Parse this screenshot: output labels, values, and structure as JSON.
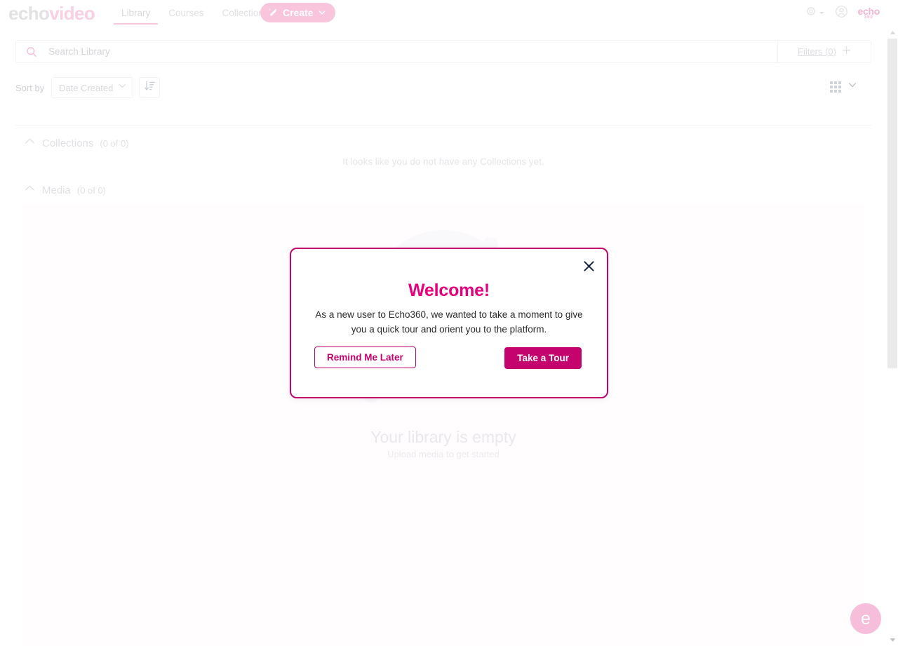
{
  "brand": {
    "part1": "echo",
    "part2": "video"
  },
  "nav": {
    "tabs": [
      {
        "label": "Library",
        "active": true
      },
      {
        "label": "Courses",
        "active": false
      },
      {
        "label": "Collections",
        "active": false
      }
    ],
    "create_label": "Create",
    "logo_echo": "echo",
    "logo_360": "360"
  },
  "search": {
    "placeholder": "Search Library",
    "value": "",
    "filters_label": "Filters (0)"
  },
  "sort": {
    "label": "Sort by",
    "value": "Date Created",
    "options": [
      "Date Created"
    ]
  },
  "sections": {
    "collections": {
      "title": "Collections",
      "count": "(0 of 0)",
      "empty_message": "It looks like you do not have any Collections yet."
    },
    "media": {
      "title": "Media",
      "count": "(0 of 0)",
      "empty_title": "Your library is empty",
      "empty_subtitle": "Upload media to get started"
    }
  },
  "help": {
    "label": "e"
  },
  "modal": {
    "title": "Welcome!",
    "body": "As a new user to Echo360, we wanted to take a moment to give you a quick tour and orient you to the platform.",
    "secondary_label": "Remind Me Later",
    "primary_label": "Take a Tour"
  },
  "colors": {
    "brand_pink": "#e5007d",
    "modal_border": "#c4036f",
    "create_bg": "#f9c5dd",
    "logo_light": "#e2e2e2",
    "logo_pink": "#f9cfe2"
  }
}
